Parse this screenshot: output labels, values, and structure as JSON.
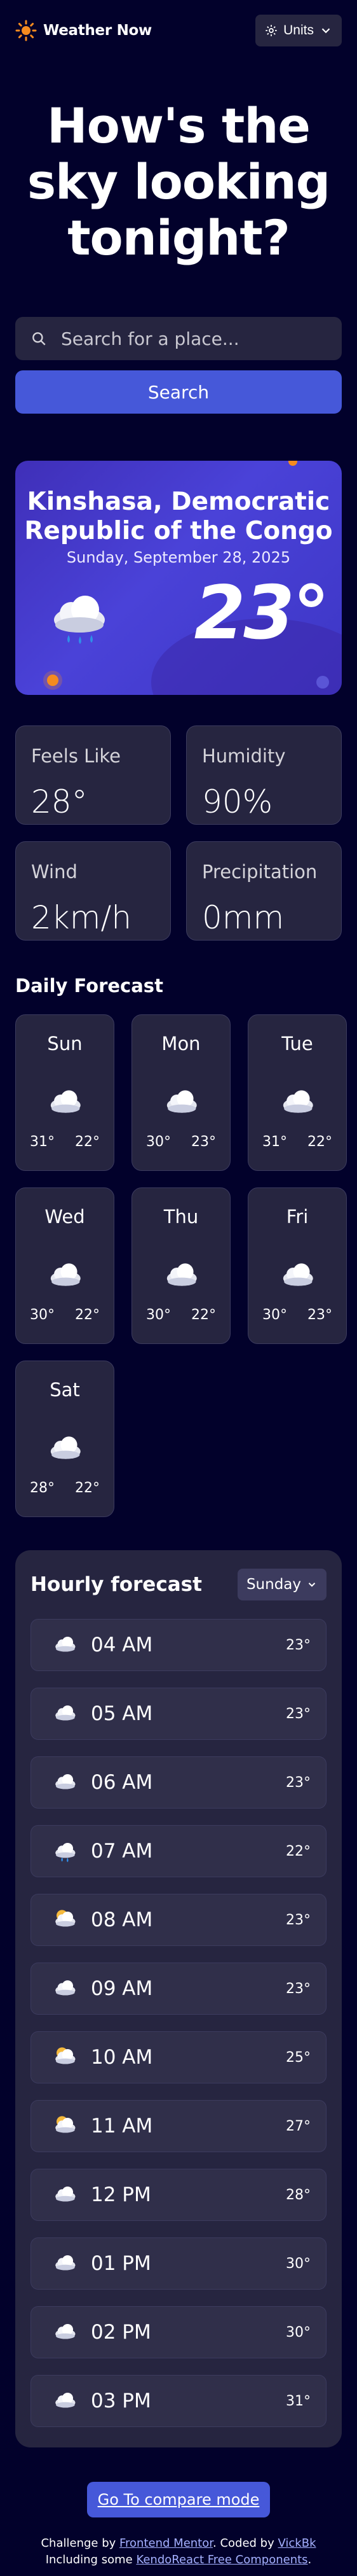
{
  "app": {
    "title": "Weather Now",
    "units_label": "Units"
  },
  "hero": {
    "title": "How's the sky looking tonight?"
  },
  "search": {
    "placeholder": "Search for a place...",
    "button_label": "Search"
  },
  "current": {
    "location": "Kinshasa, Democratic Republic of the Congo",
    "date": "Sunday, September 28, 2025",
    "temperature": "23°",
    "icon": "rain-cloud-icon"
  },
  "stats": [
    {
      "label": "Feels Like",
      "value": "28°"
    },
    {
      "label": "Humidity",
      "value": "90%"
    },
    {
      "label": "Wind",
      "value": "2km/h"
    },
    {
      "label": "Precipitation",
      "value": "0mm"
    }
  ],
  "daily": {
    "title": "Daily Forecast",
    "days": [
      {
        "day": "Sun",
        "high": "31°",
        "low": "22°",
        "icon": "cloud-icon"
      },
      {
        "day": "Mon",
        "high": "30°",
        "low": "23°",
        "icon": "cloud-icon"
      },
      {
        "day": "Tue",
        "high": "31°",
        "low": "22°",
        "icon": "cloud-icon"
      },
      {
        "day": "Wed",
        "high": "30°",
        "low": "22°",
        "icon": "cloud-icon"
      },
      {
        "day": "Thu",
        "high": "30°",
        "low": "22°",
        "icon": "cloud-icon"
      },
      {
        "day": "Fri",
        "high": "30°",
        "low": "23°",
        "icon": "cloud-icon"
      },
      {
        "day": "Sat",
        "high": "28°",
        "low": "22°",
        "icon": "cloud-icon"
      }
    ]
  },
  "hourly": {
    "title": "Hourly forecast",
    "selected_day": "Sunday",
    "hours": [
      {
        "time": "04 AM",
        "temp": "23°",
        "icon": "cloud"
      },
      {
        "time": "05 AM",
        "temp": "23°",
        "icon": "cloud"
      },
      {
        "time": "06 AM",
        "temp": "23°",
        "icon": "cloud"
      },
      {
        "time": "07 AM",
        "temp": "22°",
        "icon": "rain"
      },
      {
        "time": "08 AM",
        "temp": "23°",
        "icon": "partly-cloudy"
      },
      {
        "time": "09 AM",
        "temp": "23°",
        "icon": "cloud"
      },
      {
        "time": "10 AM",
        "temp": "25°",
        "icon": "partly-cloudy"
      },
      {
        "time": "11 AM",
        "temp": "27°",
        "icon": "partly-cloudy"
      },
      {
        "time": "12 PM",
        "temp": "28°",
        "icon": "cloud"
      },
      {
        "time": "01 PM",
        "temp": "30°",
        "icon": "cloud"
      },
      {
        "time": "02 PM",
        "temp": "30°",
        "icon": "cloud"
      },
      {
        "time": "03 PM",
        "temp": "31°",
        "icon": "cloud"
      }
    ]
  },
  "footer": {
    "compare_button": "Go To compare mode",
    "challenge_prefix": "Challenge by ",
    "challenge_link": "Frontend Mentor",
    "coded_prefix": ". Coded by ",
    "coded_link": "VickBk",
    "including_prefix": "Including some ",
    "including_link": "KendoReact Free Components",
    "including_suffix": "."
  },
  "colors": {
    "background": "#02012b",
    "card": "#262540",
    "accent": "#4658d9",
    "sun": "#f58b1f"
  }
}
